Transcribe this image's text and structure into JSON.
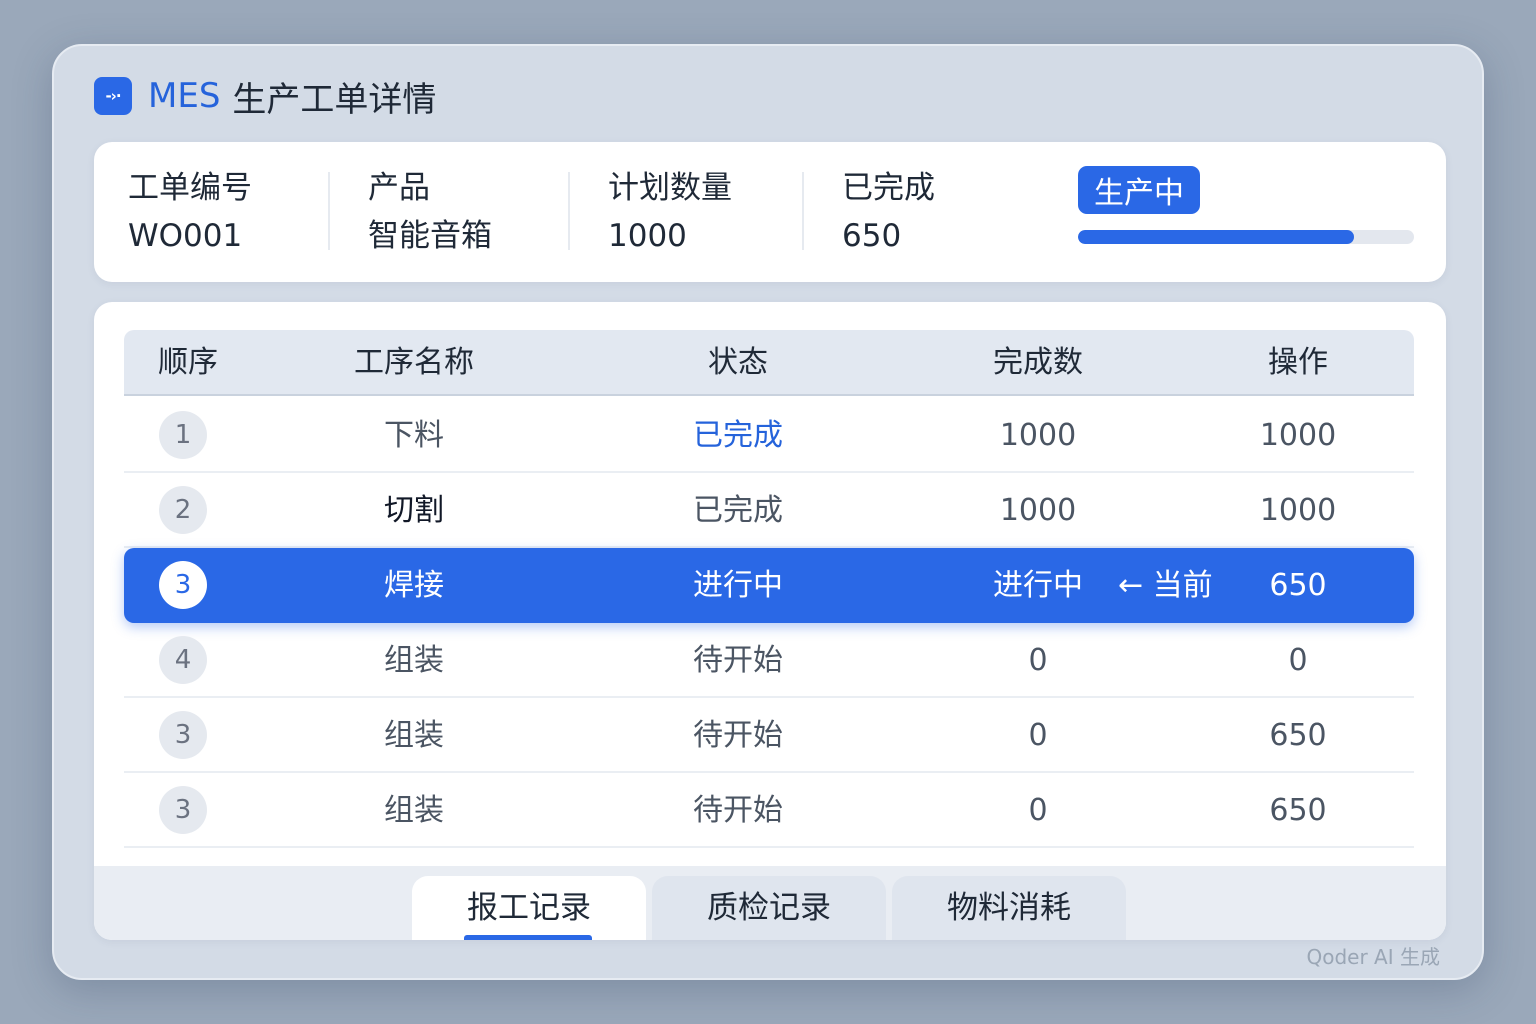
{
  "app": {
    "icon_glyph": "-›·",
    "brand": "MES",
    "title": "生产工单详情"
  },
  "summary": {
    "order_no_label": "工单编号",
    "order_no": "WO001",
    "product_label": "产品",
    "product": "智能音箱",
    "planned_label": "计划数量",
    "planned": "1000",
    "completed_label": "已完成",
    "completed": "650",
    "status": "生产中",
    "progress_fraction": 0.82
  },
  "table": {
    "headers": [
      "顺序",
      "工序名称",
      "状态",
      "完成数",
      "操作"
    ],
    "rows": [
      {
        "seq": "1",
        "name": "下料",
        "status": "已完成",
        "done": "1000",
        "op": "1000"
      },
      {
        "seq": "2",
        "name": "切割",
        "status": "已完成",
        "done": "1000",
        "op": "1000"
      },
      {
        "seq": "3",
        "name": "焊接",
        "status": "进行中",
        "done": "进行中",
        "marker": "← 当前",
        "op": "650"
      },
      {
        "seq": "4",
        "name": "组装",
        "status": "待开始",
        "done": "0",
        "op": "0"
      },
      {
        "seq": "3",
        "name": "组装",
        "status": "待开始",
        "done": "0",
        "op": "650"
      },
      {
        "seq": "3",
        "name": "组装",
        "status": "待开始",
        "done": "0",
        "op": "650"
      }
    ]
  },
  "tabs": [
    {
      "label": "报工记录"
    },
    {
      "label": "质检记录"
    },
    {
      "label": "物料消耗"
    }
  ],
  "watermark": "Qoder AI 生成",
  "colors": {
    "accent": "#2a68e6",
    "window_bg": "#d3dbe6",
    "backdrop": "#9aa8ba"
  }
}
